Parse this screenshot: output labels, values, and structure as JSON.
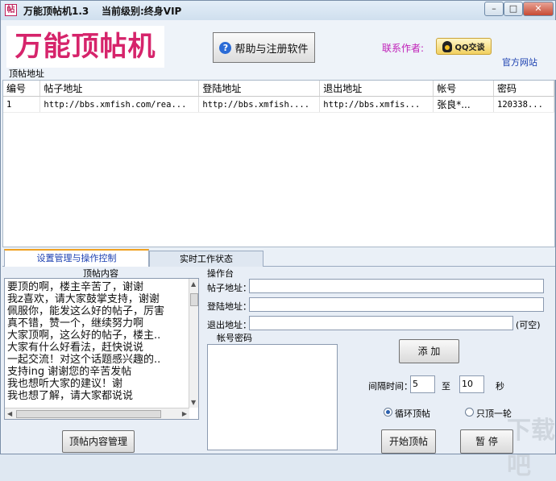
{
  "window": {
    "app_icon": "帖",
    "title": "万能顶帖机1.3",
    "level": "当前级别:终身VIP",
    "controls": {
      "minimize": "–",
      "maximize": "□",
      "close": "✕"
    }
  },
  "header": {
    "logo": "万能顶帖机",
    "help_button": "帮助与注册软件",
    "contact_label": "联系作者:",
    "qq_button": "QQ交谈",
    "official_site": "官方网站",
    "section_label": "顶帖地址"
  },
  "table": {
    "columns": [
      "编号",
      "帖子地址",
      "登陆地址",
      "退出地址",
      "帐号",
      "密码"
    ],
    "rows": [
      [
        "1",
        "http://bbs.xmfish.com/rea...",
        "http://bbs.xmfish....",
        "http://bbs.xmfis...",
        "张良*...",
        "120338..."
      ]
    ]
  },
  "tabs": [
    {
      "label": "设置管理与操作控制",
      "active": true
    },
    {
      "label": "实时工作状态",
      "active": false
    }
  ],
  "posts": {
    "header": "顶帖内容",
    "lines": [
      "要顶的啊，楼主辛苦了，谢谢",
      "我z喜欢，请大家鼓掌支持，谢谢",
      "佩服你，能发这么好的帖子，厉害",
      "真不错，赞一个，继续努力啊",
      "大家顶啊，这么好的帖子，楼主..",
      "大家有什么好看法，赶快说说",
      "一起交流！对这个话题感兴趣的..",
      "支持ing 谢谢您的辛苦发帖",
      "我也想听大家的建议！谢",
      "我也想了解，请大家都说说"
    ],
    "manage_button": "顶帖内容管理"
  },
  "ops": {
    "title": "操作台",
    "post_url_label": "帖子地址：",
    "post_url_value": "",
    "login_url_label": "登陆地址：",
    "login_url_value": "",
    "logout_url_label": "退出地址：",
    "logout_url_value": "",
    "optional_hint": "(可空)",
    "account_label": "帐号密码",
    "add_button": "添 加",
    "interval_label": "间隔时间：",
    "interval_from": "5",
    "interval_to_label": "至",
    "interval_to": "10",
    "seconds_label": "秒",
    "loop_label": "循环顶帖",
    "loop_checked": true,
    "once_label": "只顶一轮",
    "once_checked": false,
    "start_button": "开始顶帖",
    "pause_button": "暂 停"
  },
  "watermark": "下载吧"
}
